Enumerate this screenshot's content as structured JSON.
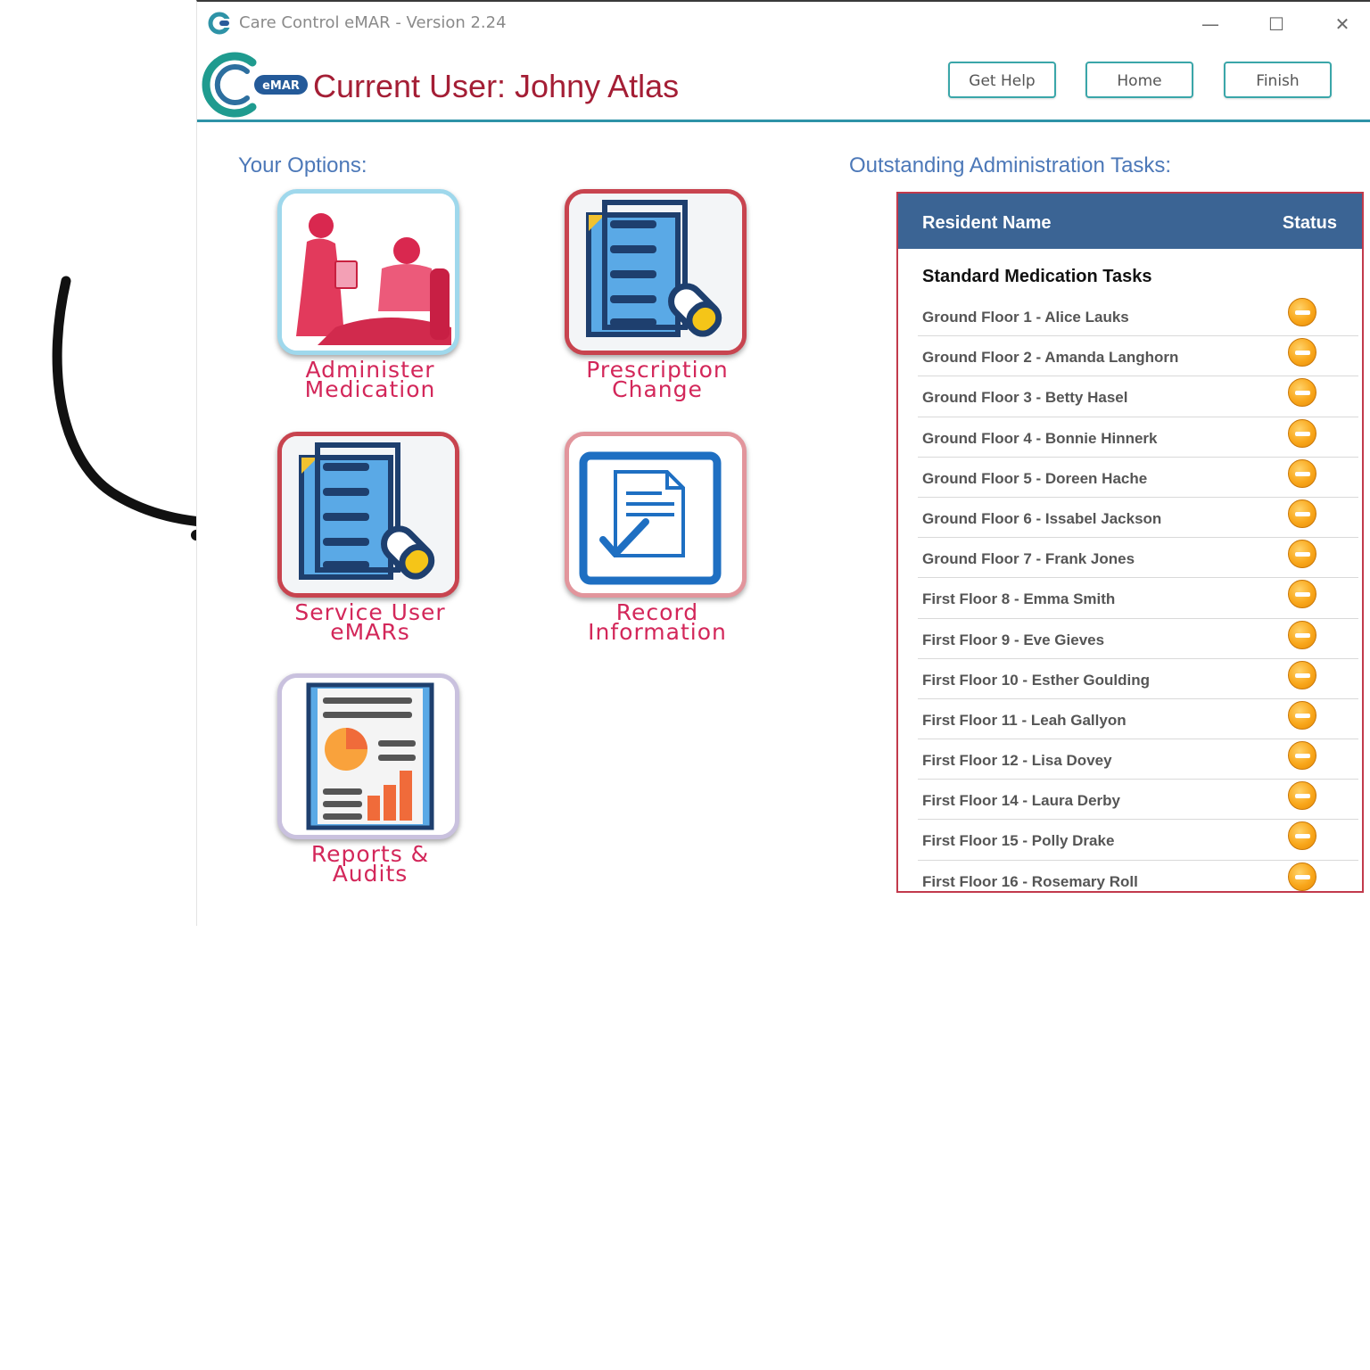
{
  "window": {
    "title": "Care Control eMAR - Version 2.24",
    "controls": {
      "minimize": "—",
      "maximize": "☐",
      "close": "✕"
    }
  },
  "header": {
    "logo_badge": "eMAR",
    "current_user": "Current User: Johny Atlas",
    "buttons": {
      "help": "Get Help",
      "home": "Home",
      "finish": "Finish"
    }
  },
  "options": {
    "title": "Your Options:",
    "items": [
      {
        "line1": "Administer",
        "line2": "Medication"
      },
      {
        "line1": "Prescription",
        "line2": "Change"
      },
      {
        "line1": "Service User",
        "line2": "eMARs"
      },
      {
        "line1": "Record",
        "line2": "Information"
      },
      {
        "line1": "Reports &",
        "line2": "Audits"
      }
    ]
  },
  "tasks": {
    "title": "Outstanding Administration Tasks:",
    "columns": {
      "name": "Resident Name",
      "status": "Status"
    },
    "group": "Standard Medication Tasks",
    "status_icon": "pending-minus-icon",
    "rows": [
      "Ground Floor 1 - Alice Lauks",
      "Ground Floor 2 - Amanda Langhorn",
      "Ground Floor 3 - Betty Hasel",
      "Ground Floor 4 - Bonnie Hinnerk",
      "Ground Floor 5 - Doreen Hache",
      "Ground Floor 6 - Issabel Jackson",
      "Ground Floor 7 - Frank Jones",
      "First Floor 8 - Emma Smith",
      "First Floor 9 - Eve Gieves",
      "First Floor 10 - Esther Goulding",
      "First Floor 11 - Leah Gallyon",
      "First Floor 12 - Lisa Dovey",
      "First Floor 14 - Laura Derby",
      "First Floor 15 - Polly Drake",
      "First Floor 16 - Rosemary Roll"
    ]
  },
  "colors": {
    "brand_red": "#a41e35",
    "tile_label": "#d3275a",
    "section_blue": "#4c78b8",
    "table_header": "#3b6494",
    "accent_teal": "#2e93a7",
    "status_amber": "#f9a71b"
  }
}
